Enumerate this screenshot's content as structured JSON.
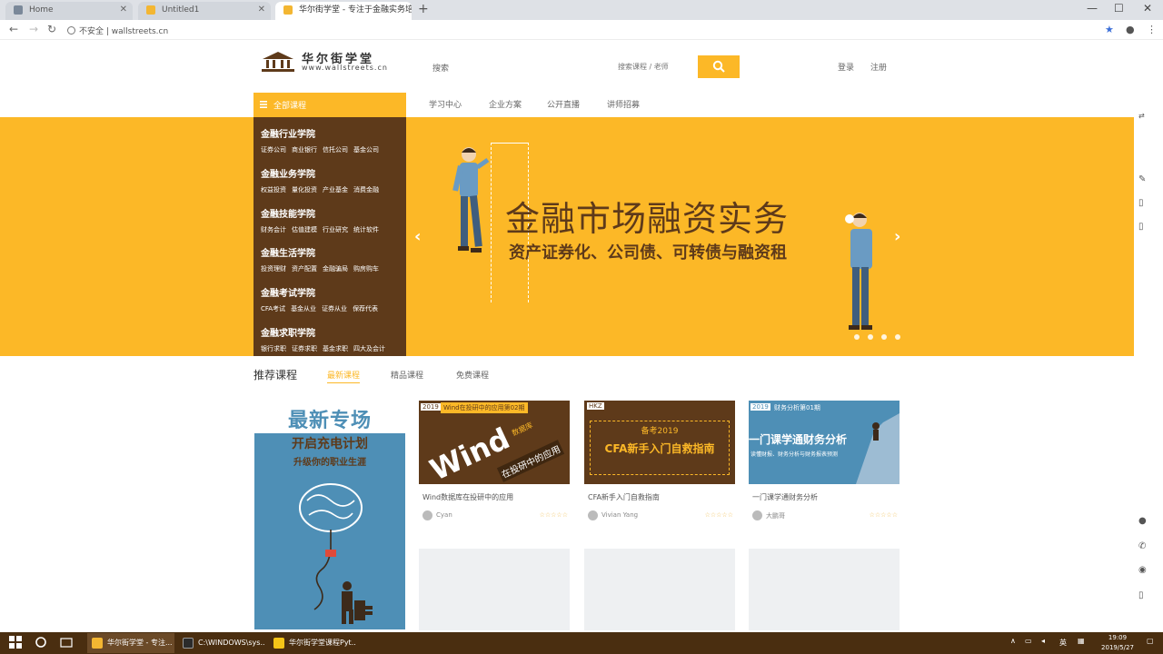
{
  "browser": {
    "tabs": [
      {
        "label": "Home",
        "active": false
      },
      {
        "label": "Untitled1",
        "active": false
      },
      {
        "label": "华尔街学堂 - 专注于金融实务培训",
        "active": true
      }
    ],
    "new_tab": "+",
    "window_controls": [
      "—",
      "☐",
      "✕"
    ],
    "security_label": "不安全",
    "url": "wallstreets.cn"
  },
  "header": {
    "logo_title": "华尔街学堂",
    "logo_sub": "www.wallstreets.cn",
    "search_label": "搜索",
    "search_placeholder": "搜索课程 / 老师",
    "login": "登录",
    "register": "注册"
  },
  "nav": {
    "all_courses": "全部课程",
    "links": [
      "学习中心",
      "企业方案",
      "公开直播",
      "讲师招募"
    ]
  },
  "side_menu": [
    {
      "title": "金融行业学院",
      "links": [
        "证券公司",
        "商业银行",
        "信托公司",
        "基金公司"
      ]
    },
    {
      "title": "金融业务学院",
      "links": [
        "权益投资",
        "量化投资",
        "产业基金",
        "消费金融"
      ]
    },
    {
      "title": "金融技能学院",
      "links": [
        "财务会计",
        "估值建模",
        "行业研究",
        "统计软件"
      ]
    },
    {
      "title": "金融生活学院",
      "links": [
        "投资理财",
        "资产配置",
        "金融骗局",
        "购房购车"
      ]
    },
    {
      "title": "金融考试学院",
      "links": [
        "CFA考试",
        "基金从业",
        "证券从业",
        "保荐代表"
      ]
    },
    {
      "title": "金融求职学院",
      "links": [
        "银行求职",
        "证券求职",
        "基金求职",
        "四大及会计"
      ]
    }
  ],
  "banner": {
    "title": "金融市场融资实务",
    "subtitle": "资产证券化、公司债、可转债与融资租",
    "prev": "‹",
    "next": "›",
    "slide_count": 4
  },
  "recommended": {
    "title": "推荐课程",
    "tabs": [
      {
        "label": "最新课程",
        "active": true
      },
      {
        "label": "精品课程",
        "active": false
      },
      {
        "label": "免费课程",
        "active": false
      }
    ]
  },
  "promo": {
    "line1": "最新专场",
    "line2": "开启充电计划",
    "line3": "升级你的职业生涯"
  },
  "courses": [
    {
      "badge": "2019",
      "series": "Wind在投研中的应用第02期",
      "img_text": "Wind",
      "img_sub": "在投研中的应用",
      "tag": "数据库",
      "title": "Wind数据库在投研中的应用",
      "author": "Cyan",
      "stats": "☆☆☆☆☆"
    },
    {
      "badge": "HKZ",
      "series": "备考2019",
      "img_text": "CFA新手入门自救指南",
      "img_sub": "",
      "tag": "",
      "title": "CFA新手入门自救指南",
      "author": "Vivian Yang",
      "stats": "☆☆☆☆☆"
    },
    {
      "badge": "2019",
      "series": "财务分析第01期",
      "img_text": "一门课学通财务分析",
      "img_sub": "读懂财报、财务分析与财务报表预测",
      "tag": "",
      "title": "一门课学通财务分析",
      "author": "大鹏哥",
      "stats": "☆☆☆☆☆"
    }
  ],
  "taskbar": {
    "apps": [
      {
        "label": "华尔街学堂 - 专注...",
        "color": "#f3b632",
        "active": true
      },
      {
        "label": "C:\\WINDOWS\\sys...",
        "color": "#2b2b2b",
        "active": false
      },
      {
        "label": "华尔街学堂课程Pyt...",
        "color": "#f5c518",
        "active": false
      }
    ],
    "ime": "英",
    "time": "19:09",
    "date": "2019/5/27"
  },
  "colors": {
    "accent": "#fcb827",
    "brown": "#5e3a1a",
    "blue": "#4e8fb6",
    "taskbar": "#4a2e10"
  }
}
